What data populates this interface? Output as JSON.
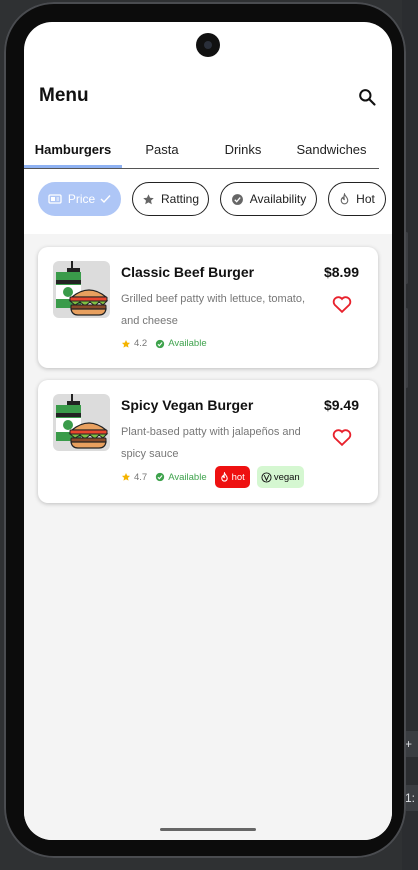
{
  "header": {
    "title": "Menu"
  },
  "tabs": [
    {
      "label": "Hamburgers",
      "active": true
    },
    {
      "label": "Pasta",
      "active": false
    },
    {
      "label": "Drinks",
      "active": false
    },
    {
      "label": "Sandwiches",
      "active": false
    }
  ],
  "filters": [
    {
      "label": "Price",
      "icon": "price-tag-icon",
      "selected": true
    },
    {
      "label": "Ratting",
      "icon": "star-icon",
      "selected": false
    },
    {
      "label": "Availability",
      "icon": "check-circle-icon",
      "selected": false
    },
    {
      "label": "Hot",
      "icon": "flame-icon",
      "selected": false
    }
  ],
  "items": [
    {
      "name": "Classic Beef Burger",
      "price": "$8.99",
      "description": "Grilled beef patty with lettuce, tomato, and cheese",
      "rating": "4.2",
      "availability": "Available",
      "tags": []
    },
    {
      "name": "Spicy Vegan Burger",
      "price": "$9.49",
      "description": "Plant-based patty with jalapeños and spicy sauce",
      "rating": "4.7",
      "availability": "Available",
      "tags": [
        "hot",
        "vegan"
      ]
    }
  ],
  "emulator_panel": {
    "add_label": "+",
    "ratio_label": "1:"
  },
  "colors": {
    "accent": "#aec6f6",
    "tab_indicator": "#8fb2f3",
    "available_green": "#3fa34d",
    "star_yellow": "#f4b400",
    "favorite_red": "#e8212c",
    "hot_red": "#ee1111",
    "vegan_green": "#d5f7d1"
  }
}
